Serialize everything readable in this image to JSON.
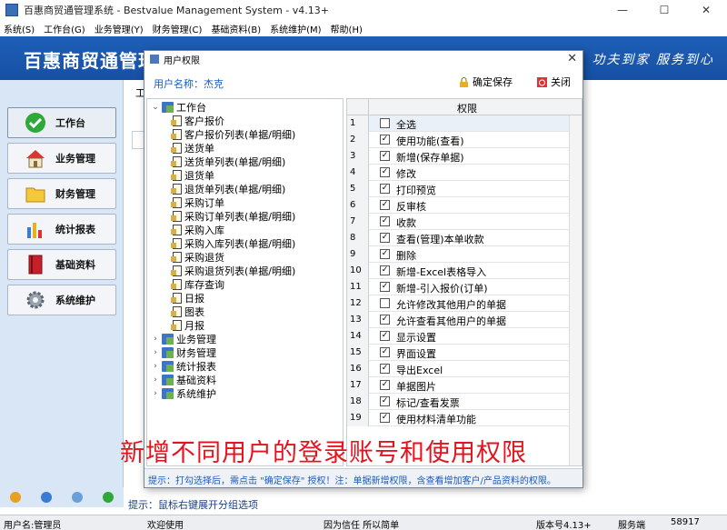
{
  "window": {
    "title": "百惠商贸通管理系统 - Bestvalue Management System - v4.13+",
    "controls": {
      "minimize": "—",
      "maximize": "☐",
      "close": "✕"
    }
  },
  "menubar": [
    "系统(S)",
    "工作台(G)",
    "业务管理(Y)",
    "财务管理(C)",
    "基础资料(B)",
    "系统维护(M)",
    "帮助(H)"
  ],
  "banner": {
    "brand": "百惠商贸通管理",
    "slogan": "功夫到家  服务到心"
  },
  "nav": [
    {
      "label": "工作台",
      "icon": "check-icon"
    },
    {
      "label": "业务管理",
      "icon": "house-icon"
    },
    {
      "label": "财务管理",
      "icon": "folder-icon"
    },
    {
      "label": "统计报表",
      "icon": "chart-icon"
    },
    {
      "label": "基础资料",
      "icon": "book-icon"
    },
    {
      "label": "系统维护",
      "icon": "gear-icon"
    }
  ],
  "main": {
    "tab_label": "工"
  },
  "hint_strip": "提示：鼠标右键展开分组选项",
  "statusbar": {
    "user": "用户名:管理员",
    "welcome": "欢迎使用",
    "motto": "因为信任 所以简单",
    "version": "版本号4.13+",
    "server": "服务端",
    "port": "58917"
  },
  "dialog": {
    "title": "用户权限",
    "close": "✕",
    "user_label": "用户名称：杰克",
    "save_button": "确定保存",
    "close_button": "关闭",
    "tree": {
      "root": "工作台",
      "children": [
        "客户报价",
        "客户报价列表(单据/明细)",
        "送货单",
        "送货单列表(单据/明细)",
        "退货单",
        "退货单列表(单据/明细)",
        "采购订单",
        "采购订单列表(单据/明细)",
        "采购入库",
        "采购入库列表(单据/明细)",
        "采购退货",
        "采购退货列表(单据/明细)",
        "库存查询",
        "日报",
        "图表",
        "月报"
      ],
      "selected_index": 2,
      "groups": [
        "业务管理",
        "财务管理",
        "统计报表",
        "基础资料",
        "系统维护"
      ]
    },
    "grid": {
      "header": "权限",
      "rows": [
        {
          "num": "1",
          "label": "全选",
          "checked": false
        },
        {
          "num": "2",
          "label": "使用功能(查看)",
          "checked": true
        },
        {
          "num": "3",
          "label": "新增(保存单据)",
          "checked": true
        },
        {
          "num": "4",
          "label": "修改",
          "checked": true
        },
        {
          "num": "5",
          "label": "打印预览",
          "checked": true
        },
        {
          "num": "6",
          "label": "反审核",
          "checked": true
        },
        {
          "num": "7",
          "label": "收款",
          "checked": true
        },
        {
          "num": "8",
          "label": "查看(管理)本单收款",
          "checked": true
        },
        {
          "num": "9",
          "label": "删除",
          "checked": true
        },
        {
          "num": "10",
          "label": "新增-Excel表格导入",
          "checked": true
        },
        {
          "num": "11",
          "label": "新增-引入报价(订单)",
          "checked": true
        },
        {
          "num": "12",
          "label": "允许修改其他用户的单据",
          "checked": false
        },
        {
          "num": "13",
          "label": "允许查看其他用户的单据",
          "checked": true
        },
        {
          "num": "14",
          "label": "显示设置",
          "checked": true
        },
        {
          "num": "15",
          "label": "界面设置",
          "checked": true
        },
        {
          "num": "16",
          "label": "导出Excel",
          "checked": true
        },
        {
          "num": "17",
          "label": "单据图片",
          "checked": true
        },
        {
          "num": "18",
          "label": "标记/查看发票",
          "checked": true
        },
        {
          "num": "19",
          "label": "使用材料清单功能",
          "checked": true
        }
      ]
    },
    "footer_hint": "提示：打勾选择后，需点击 \"确定保存\" 授权！注：单据新增权限，含查看增加客户/产品资料的权限。"
  },
  "overlay_caption": "新增不同用户的登录账号和使用权限",
  "colors": {
    "banner": "#1f5fb8",
    "caption": "#e4141f",
    "link_blue": "#1a5cbf"
  }
}
